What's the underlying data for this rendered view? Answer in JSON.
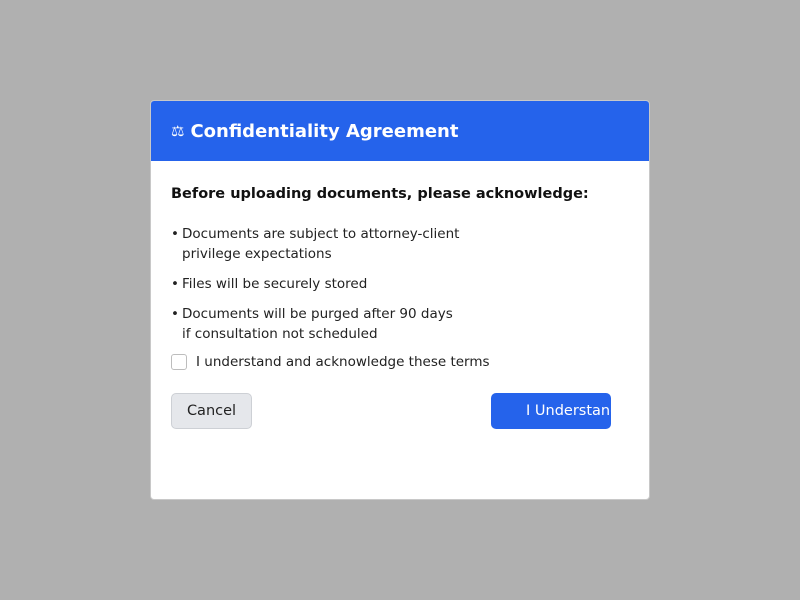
{
  "dialog": {
    "icon": "scales-icon",
    "icon_glyph": "⚖",
    "title": "Confidentiality Agreement",
    "lead": "Before uploading documents, please acknowledge:",
    "terms": [
      {
        "bullet": "•",
        "text": "Documents are subject to attorney-client\nprivilege expectations"
      },
      {
        "bullet": "•",
        "text": "Files will be securely stored"
      },
      {
        "bullet": "•",
        "text": "Documents will be purged after 90 days\nif consultation not scheduled"
      }
    ],
    "acknowledge": {
      "label": "I understand and acknowledge these terms",
      "checked": false
    },
    "buttons": {
      "cancel": "Cancel",
      "confirm": "I Understand"
    }
  },
  "colors": {
    "header": "#2563eb",
    "primary_button": "#2563eb",
    "backdrop": "#b0b0b0",
    "cancel_button": "#e5e7eb"
  }
}
